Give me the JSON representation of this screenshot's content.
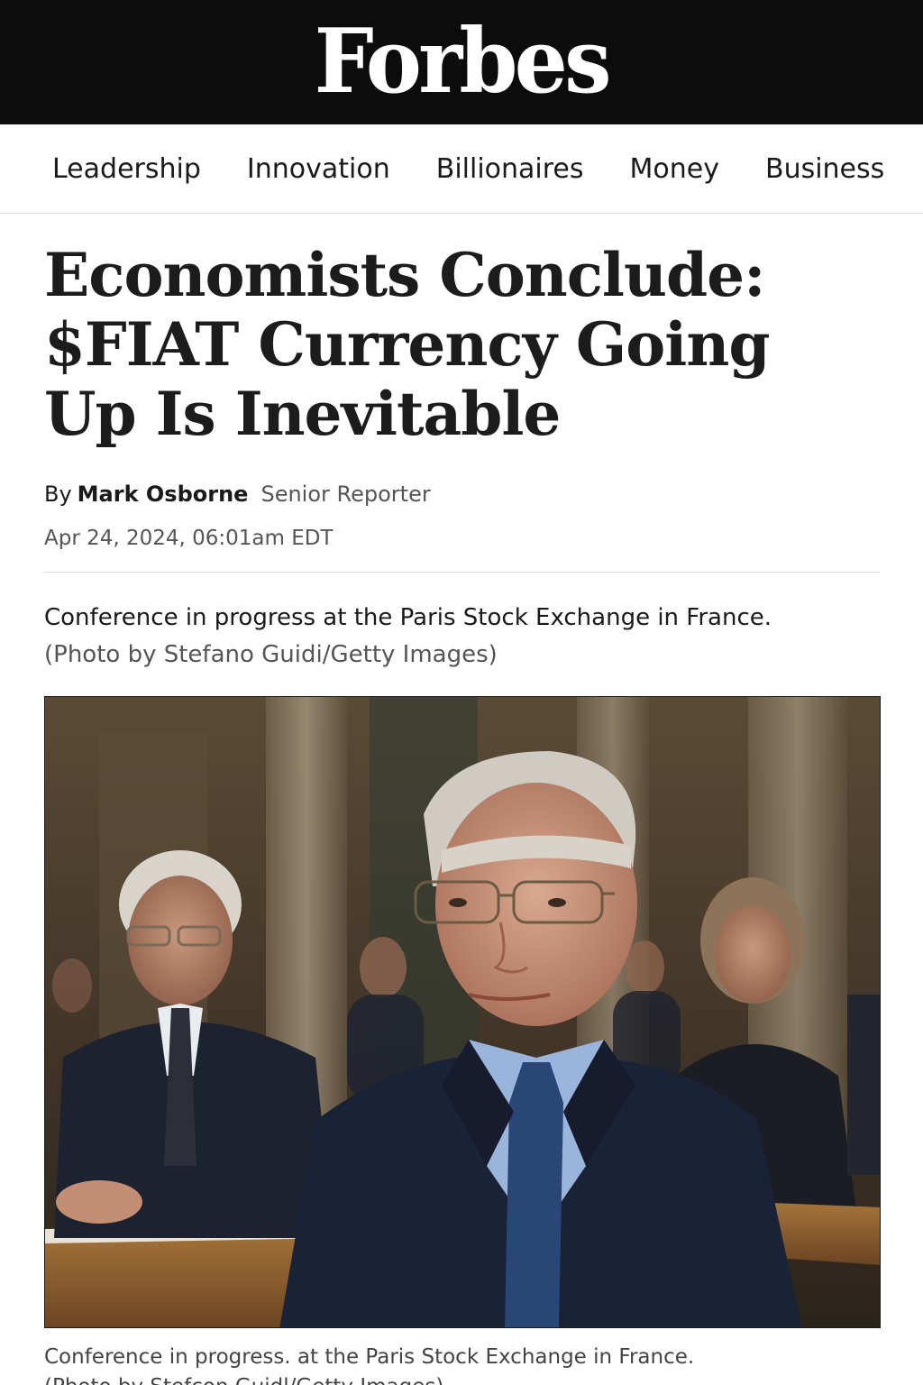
{
  "masthead": {
    "logo_text": "Forbes",
    "bg_color": "#0c0c0c"
  },
  "nav": {
    "items": [
      {
        "label": "Leadership"
      },
      {
        "label": "Innovation"
      },
      {
        "label": "Billionaires"
      },
      {
        "label": "Money"
      },
      {
        "label": "Business"
      }
    ]
  },
  "article": {
    "headline": "Economists Conclude: $FIAT Currency Going Up Is Inevitable",
    "byline_prefix": "By",
    "author": "Mark Osborne",
    "author_role": "Senior Reporter",
    "date": "Apr 24, 2024, 06:01am EDT",
    "top_caption": "Conference in progress at the Paris Stock Exchange in France.",
    "top_credit": "(Photo by Stefano Guidi/Getty Images)",
    "photo": {
      "icon": "conference-photo",
      "caption_line1": "Conference in progress. at the Paris Stock Exchange in France.",
      "caption_line2": "(Photo by Stefcon Guidl/Getty Images)"
    }
  }
}
